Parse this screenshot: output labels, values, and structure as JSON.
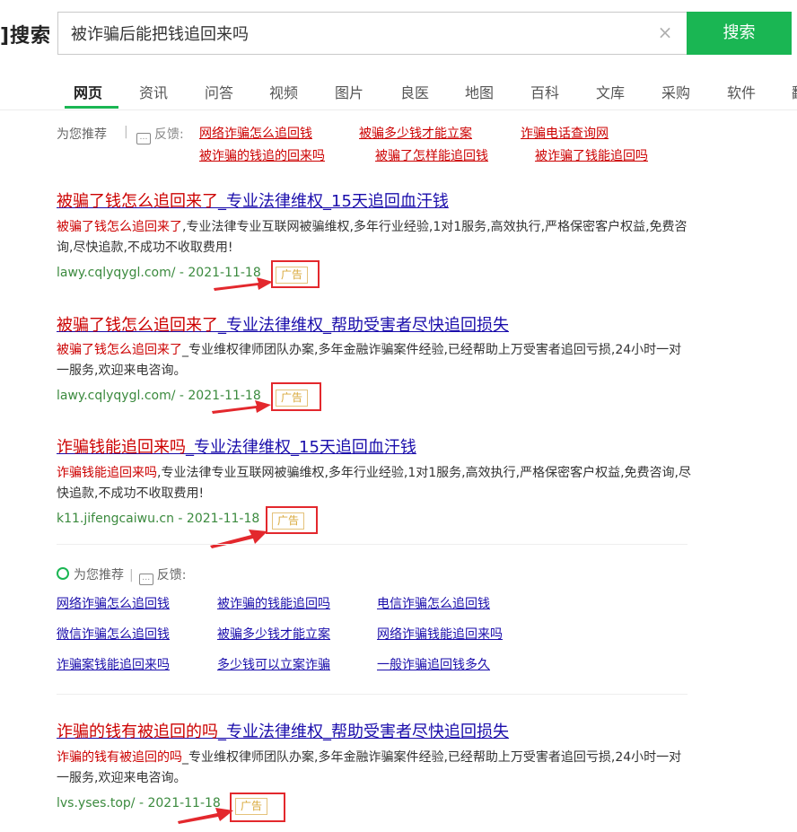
{
  "header": {
    "logo_text": "]搜索",
    "search_value": "被诈骗后能把钱追回来吗",
    "clear_icon": "×",
    "search_button": "搜索"
  },
  "nav": {
    "tabs": [
      "网页",
      "资讯",
      "问答",
      "视频",
      "图片",
      "良医",
      "地图",
      "百科",
      "文库",
      "采购",
      "软件",
      "翻"
    ],
    "active": "网页"
  },
  "top_recommend": {
    "label": "为您推荐",
    "feedback": "反馈:",
    "links": [
      "网络诈骗怎么追回钱",
      "被骗多少钱才能立案",
      "诈骗电话查询网",
      "被诈骗的钱追的回来吗",
      "被骗了怎样能追回钱",
      "被诈骗了钱能追回吗"
    ]
  },
  "results": [
    {
      "title_em": "被骗了钱怎么追回来了",
      "title_rest": "_专业法律维权_15天追回血汗钱",
      "desc_em": "被骗了钱怎么追回来了",
      "desc_rest": ",专业法律专业互联网被骗维权,多年行业经验,1对1服务,高效执行,严格保密客户权益,免费咨询,尽快追款,不成功不收取费用!",
      "url": "lawy.cqlyqygl.com/ - 2021-11-18",
      "ad": "广告"
    },
    {
      "title_em": "被骗了钱怎么追回来了",
      "title_rest": "_专业法律维权_帮助受害者尽快追回损失",
      "desc_em": "被骗了钱怎么追回来了",
      "desc_rest": "_专业维权律师团队办案,多年金融诈骗案件经验,已经帮助上万受害者追回亏损,24小时一对一服务,欢迎来电咨询。",
      "url": "lawy.cqlyqygl.com/ - 2021-11-18",
      "ad": "广告"
    },
    {
      "title_em": "诈骗钱能追回来吗",
      "title_rest": "_专业法律维权_15天追回血汗钱",
      "desc_em": "诈骗钱能追回来吗",
      "desc_rest": ",专业法律专业互联网被骗维权,多年行业经验,1对1服务,高效执行,严格保密客户权益,免费咨询,尽快追款,不成功不收取费用!",
      "url": "k11.jifengcaiwu.cn - 2021-11-18",
      "ad": "广告"
    },
    {
      "title_em": "诈骗的钱有被追回的吗",
      "title_rest": "_专业法律维权_帮助受害者尽快追回损失",
      "desc_em": "诈骗的钱有被追回的吗",
      "desc_rest": "_专业维权律师团队办案,多年金融诈骗案件经验,已经帮助上万受害者追回亏损,24小时一对一服务,欢迎来电咨询。",
      "url": "lvs.yses.top/ - 2021-11-18",
      "ad": "广告"
    }
  ],
  "mid_recommend": {
    "label": "为您推荐",
    "feedback": "反馈:",
    "links": [
      "网络诈骗怎么追回钱",
      "被诈骗的钱能追回吗",
      "电信诈骗怎么追回钱",
      "微信诈骗怎么追回钱",
      "被骗多少钱才能立案",
      "网络诈骗钱能追回来吗",
      "诈骗案钱能追回来吗",
      "多少钱可以立案诈骗",
      "一般诈骗追回钱多久"
    ]
  },
  "colors": {
    "accent_green": "#1ab653",
    "link_blue": "#1a0dab",
    "highlight_red": "#cc0000",
    "url_green": "#3b8a3e",
    "annotation_red": "#e3282d"
  }
}
